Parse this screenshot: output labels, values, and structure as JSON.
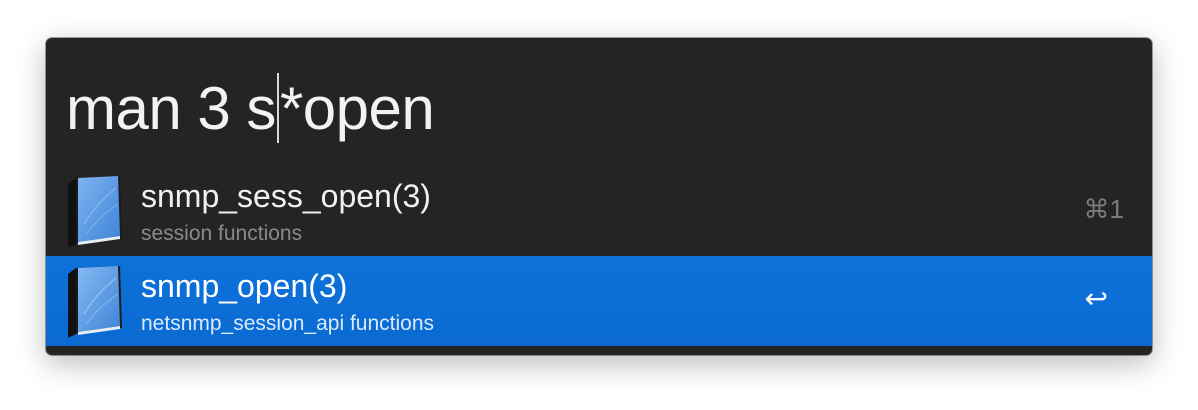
{
  "query": {
    "before_caret": "man 3 s",
    "after_caret": "*open"
  },
  "results": [
    {
      "title": "snmp_sess_open(3)",
      "subtitle": "session functions",
      "shortcut": "⌘1",
      "selected": false,
      "icon": "manual-book-icon"
    },
    {
      "title": "snmp_open(3)",
      "subtitle": "netsnmp_session_api functions",
      "shortcut": "↩",
      "selected": true,
      "icon": "manual-book-icon"
    }
  ],
  "colors": {
    "window_background": "#242424",
    "selection": "#0b6fd6",
    "text": "#f0f0f0",
    "subtitle": "#8a8a8a"
  }
}
